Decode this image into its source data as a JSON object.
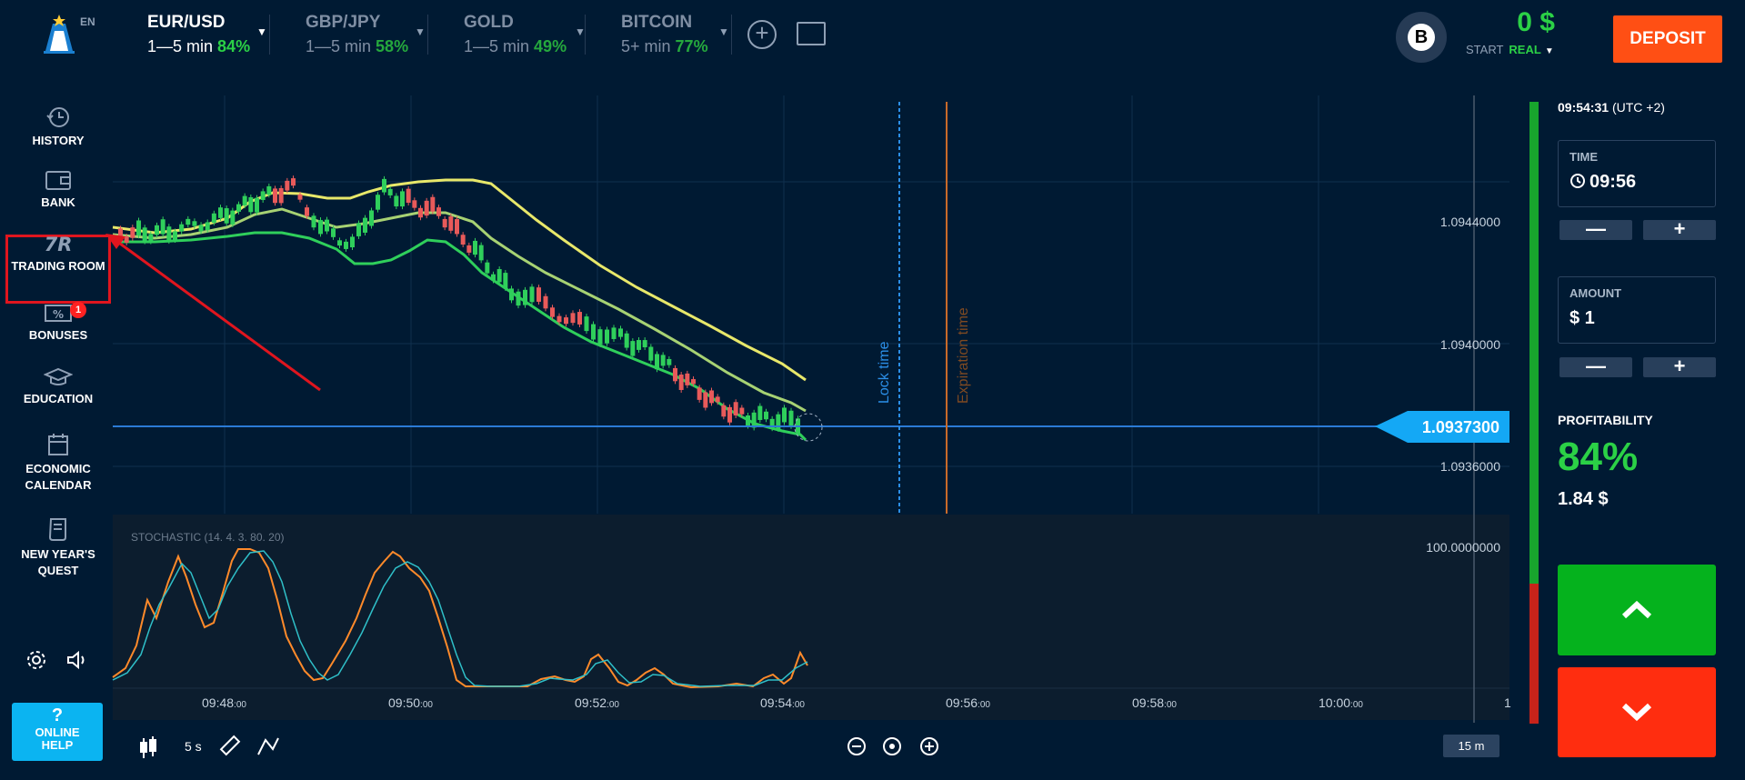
{
  "header": {
    "lang": "EN",
    "assets": [
      {
        "name": "EUR/USD",
        "duration": "1—5 min",
        "payout": "84%"
      },
      {
        "name": "GBP/JPY",
        "duration": "1—5 min",
        "payout": "58%"
      },
      {
        "name": "GOLD",
        "duration": "1—5 min",
        "payout": "49%"
      },
      {
        "name": "BITCOIN",
        "duration": "5+ min",
        "payout": "77%"
      }
    ],
    "avatar_letter": "B",
    "balance": "0 $",
    "account_start": "START",
    "account_type": "REAL",
    "deposit_label": "DEPOSIT"
  },
  "sidebar": {
    "items": [
      {
        "label": "HISTORY",
        "icon": "history-icon"
      },
      {
        "label": "BANK",
        "icon": "wallet-icon"
      },
      {
        "label": "TRADING ROOM",
        "icon": "trading-room-icon"
      },
      {
        "label": "BONUSES",
        "icon": "bonus-ticket-icon",
        "badge": "1"
      },
      {
        "label": "EDUCATION",
        "icon": "graduation-cap-icon"
      },
      {
        "label": "ECONOMIC CALENDAR",
        "icon": "calendar-icon"
      },
      {
        "label": "NEW YEAR'S QUEST",
        "icon": "scroll-icon"
      }
    ],
    "online_help_q": "?",
    "online_help": "ONLINE HELP"
  },
  "chart": {
    "price_labels": [
      "1.0944000",
      "1.0940000",
      "1.0936000"
    ],
    "current_price": "1.0937300",
    "lock_time_label": "Lock time",
    "expiration_label": "Expiration time",
    "stochastic_label": "STOCHASTIC (14. 4. 3. 80. 20)",
    "stochastic_level": "100.0000000",
    "time_labels": [
      {
        "h": "09:48",
        "s": ":00"
      },
      {
        "h": "09:50",
        "s": ":00"
      },
      {
        "h": "09:52",
        "s": ":00"
      },
      {
        "h": "09:54",
        "s": ":00"
      },
      {
        "h": "09:56",
        "s": ":00"
      },
      {
        "h": "09:58",
        "s": ":00"
      },
      {
        "h": "10:00",
        "s": ":00"
      }
    ],
    "edge_label": "1",
    "speed": "5 s",
    "zoom_period": "15 m"
  },
  "panel": {
    "clock": "09:54:31",
    "timezone": "(UTC +2)",
    "time_label": "TIME",
    "time_value": "09:56",
    "amount_label": "AMOUNT",
    "amount_value": "$ 1",
    "minus": "—",
    "plus": "+",
    "profit_label": "PROFITABILITY",
    "profit_pct": "84%",
    "profit_amount": "1.84 $"
  },
  "colors": {
    "background": "#001a33",
    "green": "#2bd146",
    "red": "#e0151e",
    "accent_blue": "#0bb4f1",
    "deposit_orange": "#ff4f14"
  }
}
